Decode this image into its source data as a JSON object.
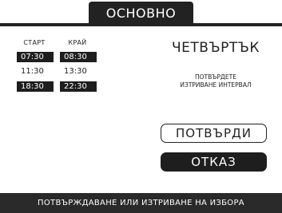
{
  "title": "ОСНОВНО",
  "schedule": {
    "start_header": "СТАРТ",
    "end_header": "КРАЙ",
    "rows": [
      {
        "start": "07:30",
        "end": "08:30",
        "selected": true
      },
      {
        "start": "11:30",
        "end": "13:30",
        "selected": false
      },
      {
        "start": "18:30",
        "end": "22:30",
        "selected": true
      }
    ]
  },
  "day": "ЧЕТВЪРТЪК",
  "prompt": {
    "line1": "ПОТВЪРДЕТЕ",
    "line2": "ИЗТРИВАНЕ ИНТЕРВАЛ"
  },
  "buttons": {
    "confirm": "ПОТВЪРДИ",
    "cancel": "ОТКАЗ"
  },
  "footer": "ПОТВЪРЖДАВАНЕ ИЛИ ИЗТРИВАНЕ НА ИЗБОРА",
  "colors": {
    "background": "#ffffff",
    "dark": "#1e1e1e",
    "text": "#222222"
  }
}
